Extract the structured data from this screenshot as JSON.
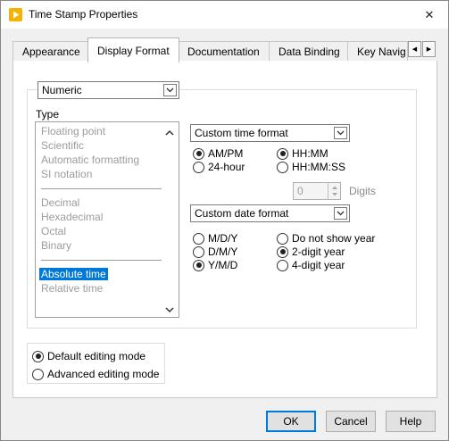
{
  "window": {
    "title": "Time Stamp Properties",
    "close_glyph": "✕"
  },
  "tabs": [
    {
      "label": "Appearance",
      "active": false
    },
    {
      "label": "Display Format",
      "active": true
    },
    {
      "label": "Documentation",
      "active": false
    },
    {
      "label": "Data Binding",
      "active": false
    },
    {
      "label": "Key Navig",
      "active": false
    }
  ],
  "tab_scroll": {
    "left_glyph": "◀",
    "right_glyph": "▶"
  },
  "format_select": {
    "value": "Numeric"
  },
  "type_list": {
    "label": "Type",
    "items": [
      "Floating point",
      "Scientific",
      "Automatic formatting",
      "SI notation",
      "Decimal",
      "Hexadecimal",
      "Octal",
      "Binary",
      "Absolute time",
      "Relative time"
    ],
    "selected": "Absolute time"
  },
  "time_format": {
    "select_value": "Custom time format",
    "ampm_label": "AM/PM",
    "h24_label": "24-hour",
    "hhmm_label": "HH:MM",
    "hhmmss_label": "HH:MM:SS",
    "digits_value": "0",
    "digits_label": "Digits"
  },
  "date_format": {
    "select_value": "Custom date format",
    "mdy_label": "M/D/Y",
    "dmy_label": "D/M/Y",
    "ymd_label": "Y/M/D",
    "no_year_label": "Do not show year",
    "two_digit_label": "2-digit year",
    "four_digit_label": "4-digit year"
  },
  "editing_mode": {
    "default_label": "Default editing mode",
    "advanced_label": "Advanced editing mode"
  },
  "buttons": {
    "ok": "OK",
    "cancel": "Cancel",
    "help": "Help"
  },
  "colors": {
    "accent": "#0078d7",
    "disabled_text": "#9c9c9c",
    "app_icon": "#f5b200"
  }
}
